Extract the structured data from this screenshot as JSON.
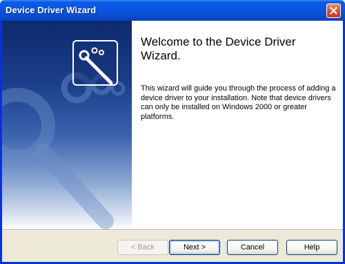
{
  "window": {
    "title": "Device Driver Wizard"
  },
  "content": {
    "heading": "Welcome to the Device Driver Wizard.",
    "body": "This wizard will guide you through the process of adding a device driver to your installation. Note that device drivers can only be installed on Windows 2000 or greater platforms."
  },
  "buttons": {
    "back": "< Back",
    "next": "Next >",
    "cancel": "Cancel",
    "help": "Help"
  },
  "icons": {
    "close": "close-icon",
    "wizard": "wand-icon"
  }
}
